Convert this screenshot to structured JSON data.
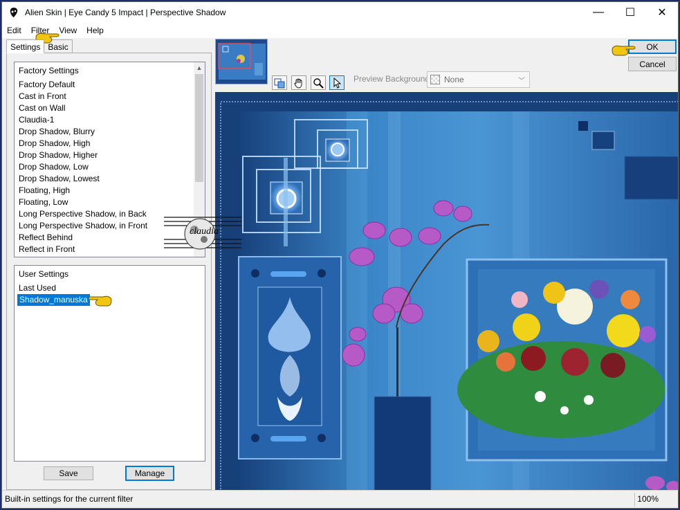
{
  "window": {
    "title": "Alien Skin | Eye Candy 5 Impact | Perspective Shadow",
    "controls": {
      "minimize": "—",
      "maximize": "☐",
      "close": "✕"
    }
  },
  "menu": [
    "Edit",
    "Filter",
    "View",
    "Help"
  ],
  "tabs": [
    "Settings",
    "Basic"
  ],
  "factory_settings": {
    "header": "Factory Settings",
    "items": [
      "Factory Default",
      "Cast in Front",
      "Cast on Wall",
      "Claudia-1",
      "Drop Shadow, Blurry",
      "Drop Shadow, High",
      "Drop Shadow, Higher",
      "Drop Shadow, Low",
      "Drop Shadow, Lowest",
      "Floating, High",
      "Floating, Low",
      "Long Perspective Shadow, in Back",
      "Long Perspective Shadow, in Front",
      "Reflect Behind",
      "Reflect in Front"
    ]
  },
  "user_settings": {
    "header": "User Settings",
    "items": [
      "Last Used"
    ],
    "selected": "Shadow_manuska"
  },
  "buttons": {
    "save": "Save",
    "manage": "Manage",
    "ok": "OK",
    "cancel": "Cancel"
  },
  "preview_background": {
    "label": "Preview Background:",
    "value": "None"
  },
  "status": {
    "text": "Built-in settings for the current filter",
    "zoom": "100%"
  },
  "watermark": {
    "text": "claudia"
  },
  "colors": {
    "accent": "#0078d7",
    "pointer": "#f2c511",
    "preview_blue": "#2f73b8"
  }
}
